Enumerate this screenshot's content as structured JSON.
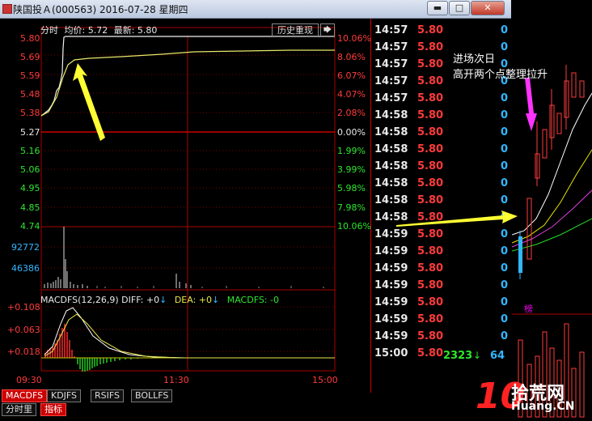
{
  "window": {
    "title": "陕国投Ａ(000563)  2016-07-28  星期四",
    "buttons": {
      "minimize": "▬",
      "maximize": "□",
      "close": "✕"
    }
  },
  "header": {
    "fenshi": "分时",
    "avg_label": "均价: 5.72",
    "latest_label": "最新: 5.80",
    "history_button": "历史重现",
    "pin_button": "🡆"
  },
  "price_axis": {
    "left": [
      "5.80",
      "5.69",
      "5.59",
      "5.48",
      "5.38",
      "5.27",
      "5.16",
      "5.06",
      "4.95",
      "4.85",
      "4.74"
    ],
    "right": [
      "10.06%",
      "8.06%",
      "6.07%",
      "4.07%",
      "2.08%",
      "0.00%",
      "1.99%",
      "3.99%",
      "5.98%",
      "7.98%",
      "10.06%"
    ]
  },
  "volume_axis": [
    "92772",
    "46386"
  ],
  "macd": {
    "label": "MACDFS(12,26,9)",
    "diff": "DIFF: +0",
    "dea": "DEA: +0",
    "macdfs": "MACDFS: -0",
    "axis": [
      "+0.108",
      "+0.063",
      "+0.018"
    ]
  },
  "time_axis": [
    "09:30",
    "11:30",
    "15:00"
  ],
  "tabs_row1": [
    "MACDFS",
    "KDJFS",
    "RSIFS",
    "BOLLFS"
  ],
  "tabs_row2": [
    "分时里",
    "指标"
  ],
  "ticks": [
    {
      "t": "14:57",
      "p": "5.80",
      "v": "0"
    },
    {
      "t": "14:57",
      "p": "5.80",
      "v": "0"
    },
    {
      "t": "14:57",
      "p": "5.80",
      "v": "0"
    },
    {
      "t": "14:57",
      "p": "5.80",
      "v": "0"
    },
    {
      "t": "14:57",
      "p": "5.80",
      "v": "0"
    },
    {
      "t": "14:58",
      "p": "5.80",
      "v": "0"
    },
    {
      "t": "14:58",
      "p": "5.80",
      "v": "0"
    },
    {
      "t": "14:58",
      "p": "5.80",
      "v": "0"
    },
    {
      "t": "14:58",
      "p": "5.80",
      "v": "0"
    },
    {
      "t": "14:58",
      "p": "5.80",
      "v": "0"
    },
    {
      "t": "14:58",
      "p": "5.80",
      "v": "0"
    },
    {
      "t": "14:58",
      "p": "5.80",
      "v": "0"
    },
    {
      "t": "14:59",
      "p": "5.80",
      "v": "0"
    },
    {
      "t": "14:59",
      "p": "5.80",
      "v": "0"
    },
    {
      "t": "14:59",
      "p": "5.80",
      "v": "0"
    },
    {
      "t": "14:59",
      "p": "5.80",
      "v": "0"
    },
    {
      "t": "14:59",
      "p": "5.80",
      "v": "0"
    },
    {
      "t": "14:59",
      "p": "5.80",
      "v": "0"
    },
    {
      "t": "14:59",
      "p": "5.80",
      "v": "0"
    },
    {
      "t": "15:00",
      "p": "5.80",
      "v": ""
    }
  ],
  "last_trade": {
    "vol": "2323",
    "arrow": "↓",
    "num": "64"
  },
  "annotation": [
    "进场次日",
    "高开两个点整理拉升"
  ],
  "rank_label": "榜",
  "watermark": {
    "num": "10",
    "cn": "拾荒网",
    "en": "Huang.CN"
  },
  "colors": {
    "up": "#ff3b3b",
    "down": "#2ee62e",
    "accent": "#33b7ff",
    "arrow_yellow": "#ffff33",
    "arrow_magenta": "#ff33ff"
  }
}
